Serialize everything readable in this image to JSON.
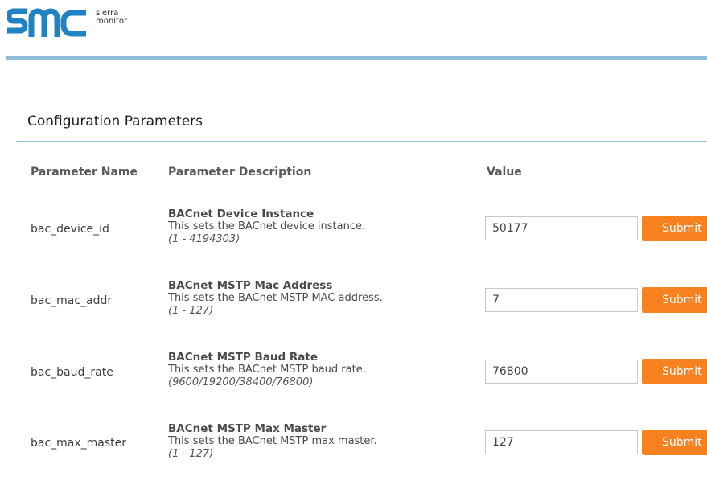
{
  "brand": {
    "line1": "sierra",
    "line2": "monitor",
    "color": "#1f82c2"
  },
  "section_title": "Configuration Parameters",
  "columns": {
    "name": "Parameter Name",
    "description": "Parameter Description",
    "value": "Value"
  },
  "accent_colors": {
    "rule": "#8fbfda",
    "submit": "#f7811e"
  },
  "params": [
    {
      "name": "bac_device_id",
      "title": "BACnet Device Instance",
      "text": "This sets the BACnet device instance.",
      "range": "(1 - 4194303)",
      "value": "50177",
      "submit_label": "Submit"
    },
    {
      "name": "bac_mac_addr",
      "title": "BACnet MSTP Mac Address",
      "text": "This sets the BACnet MSTP MAC address.",
      "range": "(1 - 127)",
      "value": "7",
      "submit_label": "Submit"
    },
    {
      "name": "bac_baud_rate",
      "title": "BACnet MSTP Baud Rate",
      "text": "This sets the BACnet MSTP baud rate.",
      "range": "(9600/19200/38400/76800)",
      "value": "76800",
      "submit_label": "Submit"
    },
    {
      "name": "bac_max_master",
      "title": "BACnet MSTP Max Master",
      "text": "This sets the BACnet MSTP max master.",
      "range": "(1 - 127)",
      "value": "127",
      "submit_label": "Submit"
    }
  ]
}
